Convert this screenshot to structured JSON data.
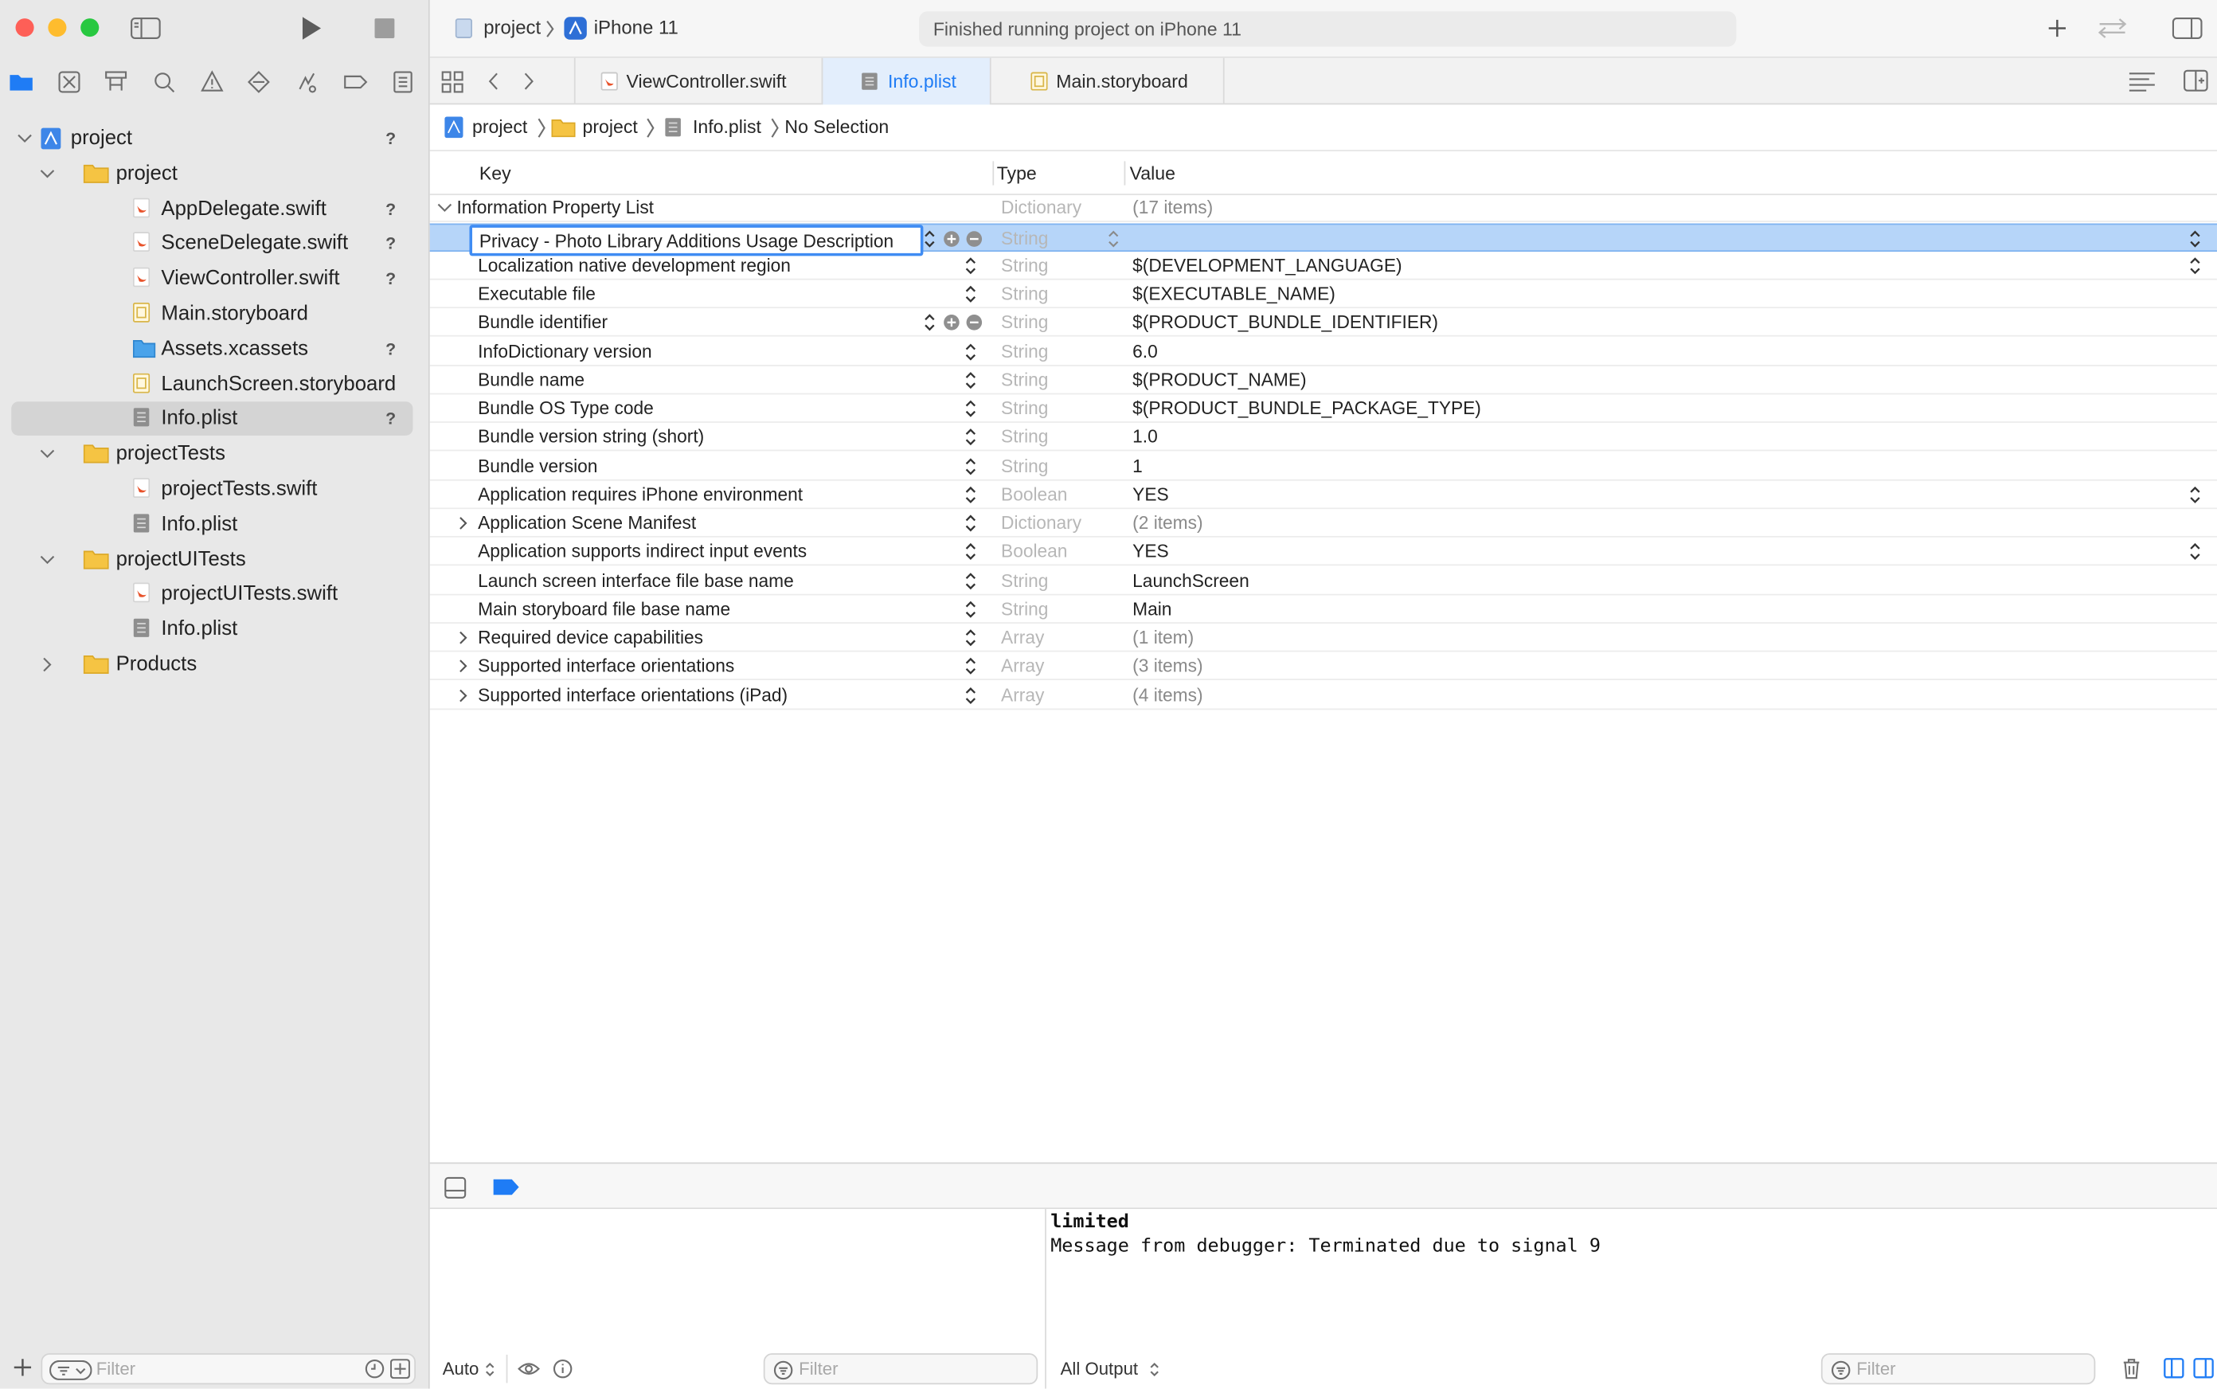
{
  "toolbar": {
    "scheme": "project",
    "device": "iPhone 11",
    "status": "Finished running project on iPhone 11"
  },
  "tabs": [
    {
      "label": "ViewController.swift",
      "active": false
    },
    {
      "label": "Info.plist",
      "active": true
    },
    {
      "label": "Main.storyboard",
      "active": false
    }
  ],
  "jumpbar": {
    "items": [
      "project",
      "project",
      "Info.plist",
      "No Selection"
    ]
  },
  "navigator": {
    "tree": [
      {
        "label": "project",
        "kind": "project",
        "badge": "?"
      },
      {
        "label": "project",
        "kind": "folder",
        "badge": ""
      },
      {
        "label": "AppDelegate.swift",
        "kind": "swift",
        "badge": "?"
      },
      {
        "label": "SceneDelegate.swift",
        "kind": "swift",
        "badge": "?"
      },
      {
        "label": "ViewController.swift",
        "kind": "swift",
        "badge": "?"
      },
      {
        "label": "Main.storyboard",
        "kind": "storyboard",
        "badge": ""
      },
      {
        "label": "Assets.xcassets",
        "kind": "assets",
        "badge": "?"
      },
      {
        "label": "LaunchScreen.storyboard",
        "kind": "storyboard",
        "badge": ""
      },
      {
        "label": "Info.plist",
        "kind": "plist",
        "badge": "?"
      },
      {
        "label": "projectTests",
        "kind": "folder",
        "badge": ""
      },
      {
        "label": "projectTests.swift",
        "kind": "swift",
        "badge": ""
      },
      {
        "label": "Info.plist",
        "kind": "plist",
        "badge": ""
      },
      {
        "label": "projectUITests",
        "kind": "folder",
        "badge": ""
      },
      {
        "label": "projectUITests.swift",
        "kind": "swift",
        "badge": ""
      },
      {
        "label": "Info.plist",
        "kind": "plist",
        "badge": ""
      },
      {
        "label": "Products",
        "kind": "folder",
        "badge": ""
      }
    ],
    "filter_placeholder": "Filter"
  },
  "plist": {
    "headers": {
      "key": "Key",
      "type": "Type",
      "value": "Value"
    },
    "root": {
      "key": "Information Property List",
      "type": "Dictionary",
      "value": "(17 items)"
    },
    "rows": [
      {
        "key": "Privacy - Photo Library Additions Usage Description",
        "type": "String",
        "value": ""
      },
      {
        "key": "Localization native development region",
        "type": "String",
        "value": "$(DEVELOPMENT_LANGUAGE)"
      },
      {
        "key": "Executable file",
        "type": "String",
        "value": "$(EXECUTABLE_NAME)"
      },
      {
        "key": "Bundle identifier",
        "type": "String",
        "value": "$(PRODUCT_BUNDLE_IDENTIFIER)"
      },
      {
        "key": "InfoDictionary version",
        "type": "String",
        "value": "6.0"
      },
      {
        "key": "Bundle name",
        "type": "String",
        "value": "$(PRODUCT_NAME)"
      },
      {
        "key": "Bundle OS Type code",
        "type": "String",
        "value": "$(PRODUCT_BUNDLE_PACKAGE_TYPE)"
      },
      {
        "key": "Bundle version string (short)",
        "type": "String",
        "value": "1.0"
      },
      {
        "key": "Bundle version",
        "type": "String",
        "value": "1"
      },
      {
        "key": "Application requires iPhone environment",
        "type": "Boolean",
        "value": "YES"
      },
      {
        "key": "Application Scene Manifest",
        "type": "Dictionary",
        "value": "(2 items)"
      },
      {
        "key": "Application supports indirect input events",
        "type": "Boolean",
        "value": "YES"
      },
      {
        "key": "Launch screen interface file base name",
        "type": "String",
        "value": "LaunchScreen"
      },
      {
        "key": "Main storyboard file base name",
        "type": "String",
        "value": "Main"
      },
      {
        "key": "Required device capabilities",
        "type": "Array",
        "value": "(1 item)"
      },
      {
        "key": "Supported interface orientations",
        "type": "Array",
        "value": "(3 items)"
      },
      {
        "key": "Supported interface orientations (iPad)",
        "type": "Array",
        "value": "(4 items)"
      }
    ]
  },
  "debug": {
    "auto_label": "Auto",
    "var_filter_placeholder": "Filter",
    "output_label": "All Output",
    "console_filter_placeholder": "Filter",
    "console_lines": [
      "limited",
      "Message from debugger: Terminated due to signal 9"
    ]
  },
  "colors": {
    "accent": "#1f7cf5",
    "selection": "#b6d5f9",
    "folder": "#f5c443"
  }
}
